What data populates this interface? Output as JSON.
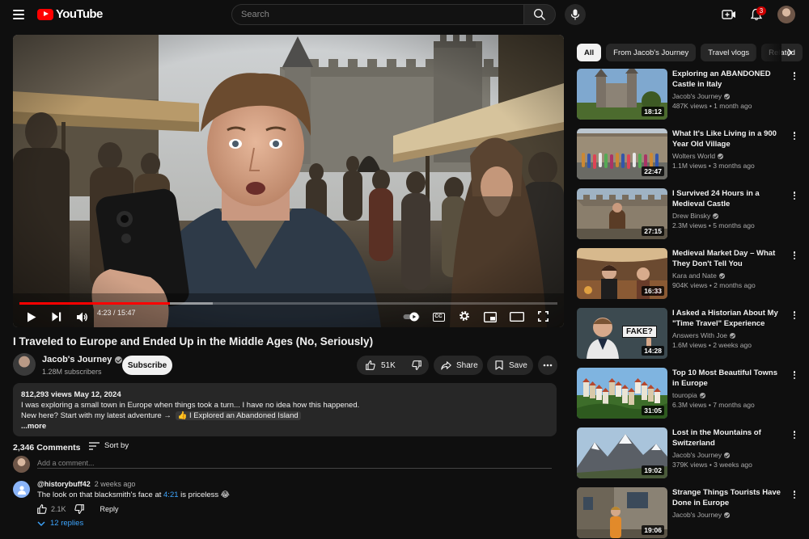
{
  "header": {
    "logo_text": "YouTube",
    "search_placeholder": "Search",
    "notification_count": "3"
  },
  "player": {
    "time": "4:23 / 15:47",
    "progress": 0.28,
    "buffered": 0.36,
    "subtitle_badge": "CC"
  },
  "video": {
    "title": "I Traveled to Europe and Ended Up in the Middle Ages (No, Seriously)",
    "channel": "Jacob's Journey",
    "subscribers": "1.28M subscribers",
    "subscribe_label": "Subscribe",
    "likes": "51K",
    "share_label": "Share",
    "save_label": "Save"
  },
  "description": {
    "stats": "812,293 views  May 12, 2024",
    "line1": "I was exploring a small town in Europe when things took a turn... I have no idea how this happened.",
    "line2_prefix": "New here? Start with my latest adventure →",
    "line2_link": "I Explored an Abandoned Island",
    "more": "...more"
  },
  "comments": {
    "count": "2,346 Comments",
    "sort_label": "Sort by",
    "add_placeholder": "Add a comment...",
    "items": [
      {
        "author": "@historybuff42",
        "age": "2 weeks ago",
        "text_before": "The look on that blacksmith's face at",
        "timestamp": "4:21",
        "text_after": "is priceless 😂",
        "likes": "2.1K",
        "reply_label": "Reply",
        "replies": "12 replies"
      }
    ]
  },
  "sidebar": {
    "chips": [
      "All",
      "From Jacob's Journey",
      "Travel vlogs",
      "Related"
    ],
    "recommendations": [
      {
        "title": "Exploring an ABANDONED Castle in Italy",
        "channel": "Jacob's Journey",
        "verified": true,
        "meta": "487K views • 1 month ago",
        "duration": "18:12",
        "thumb": "castle"
      },
      {
        "title": "What It's Like Living in a 900 Year Old Village",
        "channel": "Wolters World",
        "verified": true,
        "meta": "1.1M views • 3 months ago",
        "duration": "22:47",
        "thumb": "village"
      },
      {
        "title": "I Survived 24 Hours in a Medieval Castle",
        "channel": "Drew Binsky",
        "verified": true,
        "meta": "2.3M views • 5 months ago",
        "duration": "27:15",
        "thumb": "medieval"
      },
      {
        "title": "Medieval Market Day – What They Don't Tell You",
        "channel": "Kara and Nate",
        "verified": true,
        "meta": "904K views • 2 months ago",
        "duration": "16:33",
        "thumb": "market"
      },
      {
        "title": "I Asked a Historian About My \"Time Travel\" Experience",
        "channel": "Answers With Joe",
        "verified": true,
        "meta": "1.6M views • 2 weeks ago",
        "duration": "14:28",
        "thumb": "historian",
        "thumb_text": "FAKE?"
      },
      {
        "title": "Top 10 Most Beautiful Towns in Europe",
        "channel": "touropia",
        "verified": true,
        "meta": "6.3M views • 7 months ago",
        "duration": "31:05",
        "thumb": "towns"
      },
      {
        "title": "Lost in the Mountains of Switzerland",
        "channel": "Jacob's Journey",
        "verified": true,
        "meta": "379K views • 3 weeks ago",
        "duration": "19:02",
        "thumb": "mountains"
      },
      {
        "title": "Strange Things Tourists Have Done in Europe",
        "channel": "Jacob's Journey",
        "verified": true,
        "meta": "",
        "duration": "19:06",
        "thumb": "street"
      }
    ]
  },
  "colors": {
    "background": "#0f0f0f",
    "surface": "#272727",
    "brand_red": "#ff0000",
    "link_blue": "#3ea6ff",
    "text_primary": "#f1f1f1",
    "text_secondary": "#aaaaaa"
  }
}
